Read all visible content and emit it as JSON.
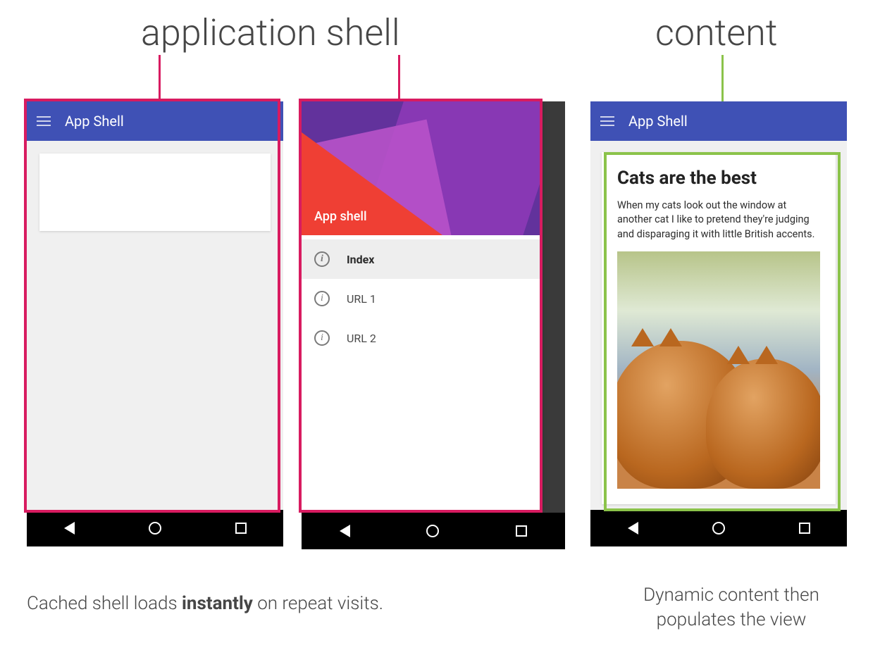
{
  "titles": {
    "app_shell": "application shell",
    "content": "content"
  },
  "appbar_title": "App Shell",
  "drawer": {
    "header_label": "App shell",
    "items": [
      {
        "label": "Index",
        "selected": true
      },
      {
        "label": "URL 1",
        "selected": false
      },
      {
        "label": "URL 2",
        "selected": false
      }
    ]
  },
  "article": {
    "heading": "Cats are the best",
    "body": "When my cats look out the window at another cat I like to pretend they're judging and disparaging it with little British accents."
  },
  "captions": {
    "left_pre": "Cached shell loads ",
    "left_bold": "instantly",
    "left_post": " on repeat visits.",
    "right": "Dynamic content then populates the view"
  },
  "colors": {
    "shell_outline": "#d81b60",
    "content_outline": "#8bc34a",
    "appbar": "#3f51b5"
  }
}
